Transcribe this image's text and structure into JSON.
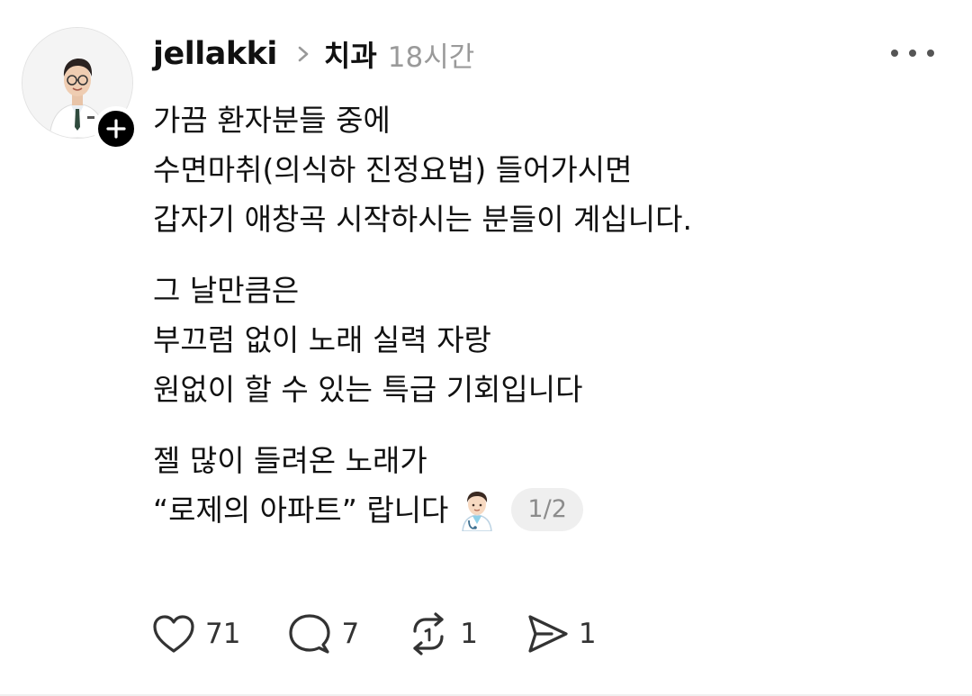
{
  "author": {
    "username": "jellakki",
    "topic": "치과",
    "time": "18시간"
  },
  "post": {
    "paragraphs": [
      [
        "가끔 환자분들 중에",
        "수면마취(의식하 진정요법) 들어가시면",
        "갑자기 애창곡 시작하시는 분들이 계십니다."
      ],
      [
        "그 날만큼은",
        "부끄럼 없이 노래 실력 자랑",
        "원없이 할 수 있는 특급 기회입니다"
      ],
      [
        "젤 많이 들려온 노래가",
        "“로제의 아파트” 랍니다"
      ]
    ],
    "page_indicator": "1/2"
  },
  "actions": {
    "likes": "71",
    "comments": "7",
    "reposts": "1",
    "shares": "1"
  },
  "icons": {
    "follow": "plus-icon",
    "chevron": "chevron-right-icon",
    "more": "more-horizontal-icon",
    "like": "heart-icon",
    "comment": "comment-bubble-icon",
    "repost": "repost-arrows-icon",
    "share": "send-icon",
    "emoji": "doctor-emoji-icon"
  },
  "colors": {
    "text": "#111111",
    "muted": "#9a9a9a",
    "pill_bg": "#efefef"
  }
}
